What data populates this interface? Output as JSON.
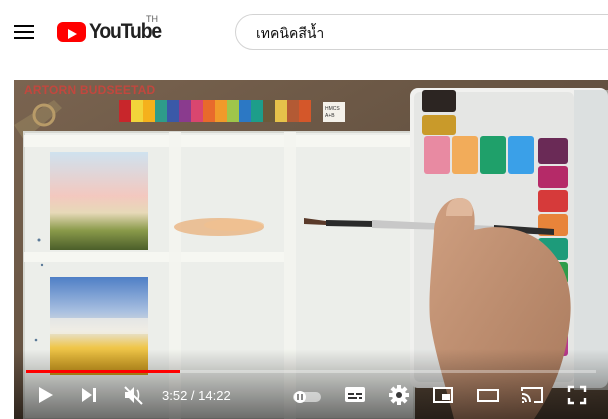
{
  "header": {
    "logo_text": "YouTube",
    "region_code": "TH",
    "search_query": "เทคนิคสีน้ำ"
  },
  "video": {
    "channel_watermark": "ARTORN BUDSEETAD",
    "card_label_line1": "HMCS",
    "card_label_line2": "A+B",
    "current_time": "3:52",
    "duration": "14:22",
    "time_display": "3:52 / 14:22",
    "progress_fraction": 0.27
  },
  "colors": {
    "brand_red": "#ff0000",
    "progress_red": "#ff0000",
    "channel_text": "#c2473e"
  },
  "icons": {
    "menu": "hamburger-menu-icon",
    "play": "play-icon",
    "next": "next-icon",
    "mute": "volume-muted-icon",
    "autoplay": "autoplay-toggle-icon",
    "subtitles": "subtitles-icon",
    "settings": "gear-icon",
    "miniplayer": "miniplayer-icon",
    "theater": "theater-mode-icon",
    "cast": "cast-icon",
    "fullscreen": "fullscreen-icon"
  }
}
